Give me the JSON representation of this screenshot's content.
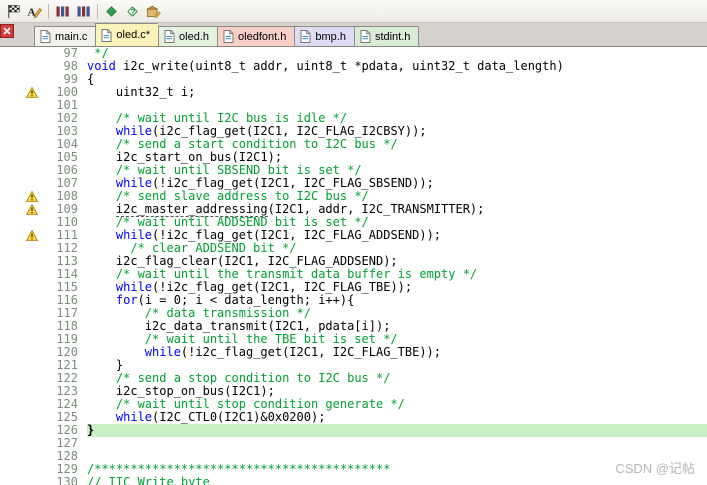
{
  "toolbar": {
    "icons": [
      "flag-icon",
      "edit-config-icon",
      "flash-download-icon",
      "system-components-icon",
      "pack-installer-icon",
      "pack-help-icon",
      "manage-rte-icon"
    ]
  },
  "tab_bar": {
    "close_icon": "close-icon"
  },
  "tabs": [
    {
      "label": "main.c",
      "bg": "#f2f1ec",
      "active": false
    },
    {
      "label": "oled.c*",
      "bg": "#fbf3b9",
      "active": true
    },
    {
      "label": "oled.h",
      "bg": "#e6f2e0",
      "active": false
    },
    {
      "label": "oledfont.h",
      "bg": "#f8d0c8",
      "active": false
    },
    {
      "label": "bmp.h",
      "bg": "#dedbf4",
      "active": false
    },
    {
      "label": "stdint.h",
      "bg": "#d9ecd5",
      "active": false
    }
  ],
  "colors": {
    "keyword": "#0000ff",
    "comment": "#00a033",
    "line_highlight": "#c9efc3",
    "warning": "#ffd24a"
  },
  "editor": {
    "lines": [
      {
        "no": 97,
        "seg": [
          {
            "t": "c",
            "s": " */"
          }
        ]
      },
      {
        "no": 98,
        "seg": [
          {
            "t": "k",
            "s": "void"
          },
          {
            "t": "p",
            "s": " i2c_write(uint8_t addr, uint8_t *pdata, uint32_t data_length)"
          }
        ]
      },
      {
        "no": 99,
        "seg": [
          {
            "t": "p",
            "s": "{"
          }
        ]
      },
      {
        "no": 100,
        "w": true,
        "seg": [
          {
            "t": "p",
            "s": "    uint32_t i;"
          }
        ]
      },
      {
        "no": 101,
        "seg": []
      },
      {
        "no": 102,
        "seg": [
          {
            "t": "p",
            "s": "    "
          },
          {
            "t": "c",
            "s": "/* wait until I2C bus is idle */"
          }
        ]
      },
      {
        "no": 103,
        "seg": [
          {
            "t": "p",
            "s": "    "
          },
          {
            "t": "k",
            "s": "while"
          },
          {
            "t": "p",
            "s": "(i2c_flag_get(I2C1, I2C_FLAG_I2CBSY));"
          }
        ]
      },
      {
        "no": 104,
        "seg": [
          {
            "t": "p",
            "s": "    "
          },
          {
            "t": "c",
            "s": "/* send a start condition to I2C bus */"
          }
        ]
      },
      {
        "no": 105,
        "seg": [
          {
            "t": "p",
            "s": "    i2c_start_on_bus(I2C1);"
          }
        ]
      },
      {
        "no": 106,
        "seg": [
          {
            "t": "p",
            "s": "    "
          },
          {
            "t": "c",
            "s": "/* wait until SBSEND bit is set */"
          }
        ]
      },
      {
        "no": 107,
        "seg": [
          {
            "t": "p",
            "s": "    "
          },
          {
            "t": "k",
            "s": "while"
          },
          {
            "t": "p",
            "s": "(!i2c_flag_get(I2C1, I2C_FLAG_SBSEND));"
          }
        ]
      },
      {
        "no": 108,
        "w": true,
        "seg": [
          {
            "t": "p",
            "s": "    "
          },
          {
            "t": "c",
            "s": "/* send slave address to I2C bus */"
          }
        ]
      },
      {
        "no": 109,
        "w": true,
        "seg": [
          {
            "t": "p",
            "s": "    "
          },
          {
            "t": "u",
            "s": "i2c_master_addressing"
          },
          {
            "t": "p",
            "s": "(I2C1, addr, I2C_TRANSMITTER);"
          }
        ]
      },
      {
        "no": 110,
        "seg": [
          {
            "t": "p",
            "s": "    "
          },
          {
            "t": "c",
            "s": "/* wait until ADDSEND bit is set */"
          }
        ]
      },
      {
        "no": 111,
        "w": true,
        "seg": [
          {
            "t": "p",
            "s": "    "
          },
          {
            "t": "k",
            "s": "while"
          },
          {
            "t": "p",
            "s": "(!i2c_flag_get(I2C1, I2C_FLAG_ADDSEND));"
          }
        ]
      },
      {
        "no": 112,
        "seg": [
          {
            "t": "p",
            "s": "      "
          },
          {
            "t": "c",
            "s": "/* clear ADDSEND bit */"
          }
        ]
      },
      {
        "no": 113,
        "seg": [
          {
            "t": "p",
            "s": "    i2c_flag_clear(I2C1, I2C_FLAG_ADDSEND);"
          }
        ]
      },
      {
        "no": 114,
        "seg": [
          {
            "t": "p",
            "s": "    "
          },
          {
            "t": "c",
            "s": "/* wait until the transmit data buffer is empty */"
          }
        ]
      },
      {
        "no": 115,
        "seg": [
          {
            "t": "p",
            "s": "    "
          },
          {
            "t": "k",
            "s": "while"
          },
          {
            "t": "p",
            "s": "(!i2c_flag_get(I2C1, I2C_FLAG_TBE));"
          }
        ]
      },
      {
        "no": 116,
        "seg": [
          {
            "t": "p",
            "s": "    "
          },
          {
            "t": "k",
            "s": "for"
          },
          {
            "t": "p",
            "s": "(i = 0; i < data_length; i++){"
          }
        ]
      },
      {
        "no": 117,
        "seg": [
          {
            "t": "p",
            "s": "        "
          },
          {
            "t": "c",
            "s": "/* data transmission */"
          }
        ]
      },
      {
        "no": 118,
        "seg": [
          {
            "t": "p",
            "s": "        i2c_data_transmit(I2C1, pdata[i]);"
          }
        ]
      },
      {
        "no": 119,
        "seg": [
          {
            "t": "p",
            "s": "        "
          },
          {
            "t": "c",
            "s": "/* wait until the TBE bit is set */"
          }
        ]
      },
      {
        "no": 120,
        "seg": [
          {
            "t": "p",
            "s": "        "
          },
          {
            "t": "k",
            "s": "while"
          },
          {
            "t": "p",
            "s": "(!i2c_flag_get(I2C1, I2C_FLAG_TBE));"
          }
        ]
      },
      {
        "no": 121,
        "seg": [
          {
            "t": "p",
            "s": "    }"
          }
        ]
      },
      {
        "no": 122,
        "seg": [
          {
            "t": "p",
            "s": "    "
          },
          {
            "t": "c",
            "s": "/* send a stop condition to I2C bus */"
          }
        ]
      },
      {
        "no": 123,
        "seg": [
          {
            "t": "p",
            "s": "    i2c_stop_on_bus(I2C1);"
          }
        ]
      },
      {
        "no": 124,
        "seg": [
          {
            "t": "p",
            "s": "    "
          },
          {
            "t": "c",
            "s": "/* wait until stop condition generate */"
          }
        ]
      },
      {
        "no": 125,
        "seg": [
          {
            "t": "p",
            "s": "    "
          },
          {
            "t": "k",
            "s": "while"
          },
          {
            "t": "p",
            "s": "(I2C_CTL0(I2C1)&0x0200);"
          }
        ]
      },
      {
        "no": 126,
        "hl": true,
        "seg": [
          {
            "t": "b",
            "s": "}"
          }
        ]
      },
      {
        "no": 127,
        "seg": []
      },
      {
        "no": 128,
        "seg": []
      },
      {
        "no": 129,
        "seg": [
          {
            "t": "c",
            "s": "/*****************************************"
          }
        ]
      },
      {
        "no": 130,
        "seg": [
          {
            "t": "c",
            "s": "// IIC Write byte"
          }
        ]
      }
    ]
  },
  "watermark": "CSDN @记帖"
}
